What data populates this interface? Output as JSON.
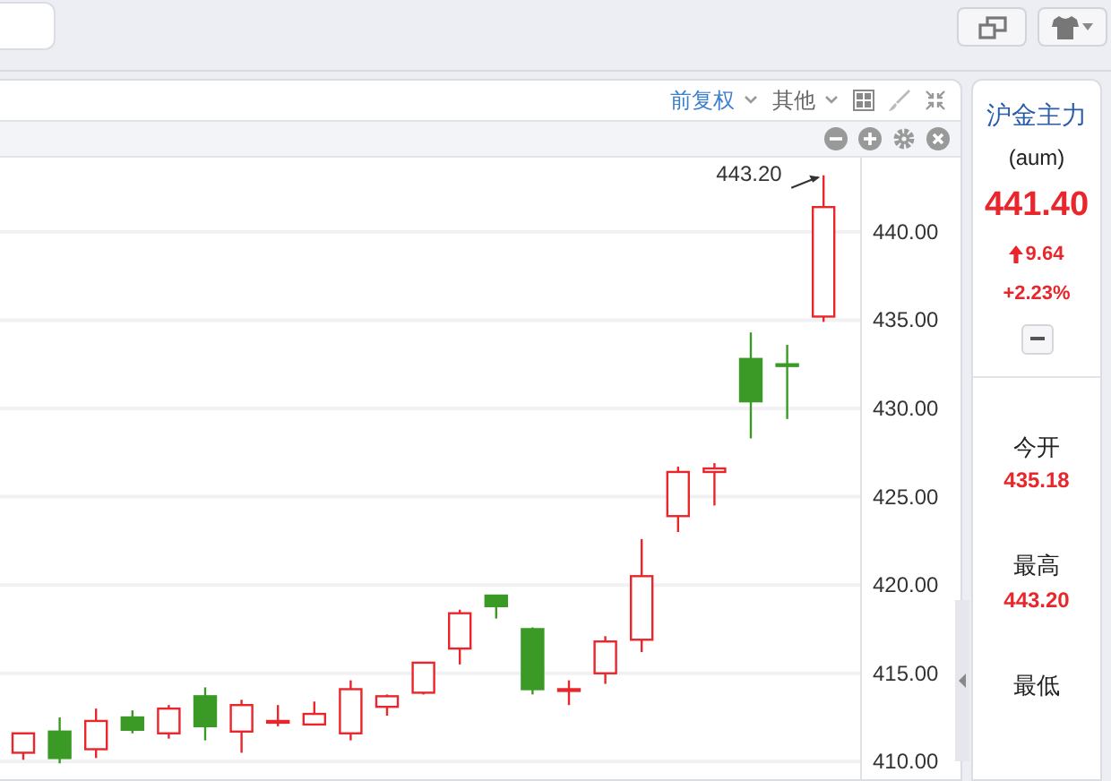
{
  "toolbar": {
    "menus": [
      {
        "label": "前复权",
        "selected": true
      },
      {
        "label": "其他",
        "selected": false
      }
    ]
  },
  "chart_data": {
    "type": "candlestick",
    "grid": true,
    "ohlc": [
      [
        410.5,
        411.6,
        410.1,
        411.6
      ],
      [
        411.7,
        412.5,
        409.9,
        410.2
      ],
      [
        410.7,
        413.0,
        410.2,
        412.3
      ],
      [
        412.5,
        412.9,
        411.6,
        411.8
      ],
      [
        411.6,
        413.2,
        411.3,
        413.0
      ],
      [
        413.7,
        414.2,
        411.2,
        412.0
      ],
      [
        411.7,
        413.5,
        410.5,
        413.2
      ],
      [
        412.2,
        413.2,
        412.0,
        412.3
      ],
      [
        412.1,
        413.4,
        412.1,
        412.7
      ],
      [
        411.6,
        414.6,
        411.2,
        414.1
      ],
      [
        413.1,
        413.8,
        412.6,
        413.7
      ],
      [
        413.9,
        415.6,
        413.8,
        415.6
      ],
      [
        416.4,
        418.6,
        415.5,
        418.4
      ],
      [
        419.4,
        419.4,
        418.1,
        418.8
      ],
      [
        417.5,
        417.6,
        413.8,
        414.1
      ],
      [
        414.0,
        414.6,
        413.2,
        414.1
      ],
      [
        415.0,
        417.1,
        414.4,
        416.8
      ],
      [
        416.9,
        422.6,
        416.2,
        420.5
      ],
      [
        423.9,
        426.7,
        423.0,
        426.4
      ],
      [
        426.4,
        426.9,
        424.5,
        426.6
      ],
      [
        432.8,
        434.3,
        428.3,
        430.4
      ],
      [
        432.5,
        433.6,
        429.4,
        432.4
      ],
      [
        435.2,
        443.2,
        434.9,
        441.4
      ]
    ],
    "ylim": [
      408.9,
      444.2
    ],
    "yticks": [
      {
        "value": 410,
        "label": "410.00"
      },
      {
        "value": 415,
        "label": "415.00"
      },
      {
        "value": 420,
        "label": "420.00"
      },
      {
        "value": 425,
        "label": "425.00"
      },
      {
        "value": 430,
        "label": "430.00"
      },
      {
        "value": 435,
        "label": "435.00"
      },
      {
        "value": 440,
        "label": "440.00"
      }
    ],
    "annotations": [
      "443.20"
    ]
  },
  "quote": {
    "name": "沪金主力",
    "code": "(aum)",
    "price": "441.40",
    "change": "9.64",
    "change_pct": "+2.23%"
  },
  "stats": [
    {
      "label": "今开",
      "value": "435.18"
    },
    {
      "label": "最高",
      "value": "443.20"
    },
    {
      "label": "最低"
    }
  ]
}
